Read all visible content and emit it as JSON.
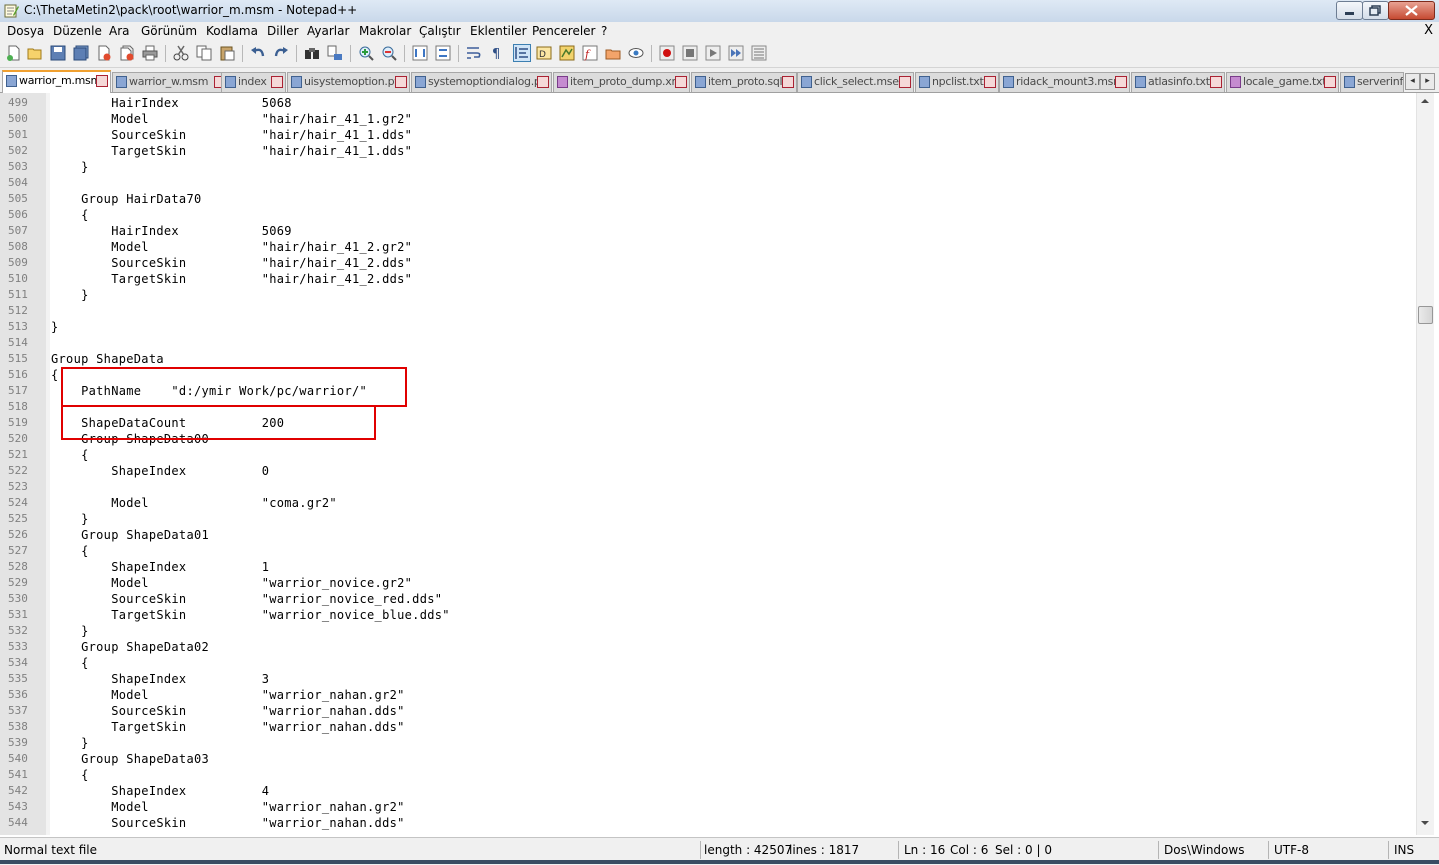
{
  "window": {
    "title": "C:\\ThetaMetin2\\pack\\root\\warrior_m.msm - Notepad++",
    "icon": "notepad-icon"
  },
  "menu": {
    "items": [
      "Dosya",
      "Düzenle",
      "Ara",
      "Görünüm",
      "Kodlama",
      "Diller",
      "Ayarlar",
      "Makrolar",
      "Çalıştır",
      "Eklentiler",
      "Pencereler",
      "?"
    ],
    "close_doc": "X"
  },
  "toolbar": {
    "icons": [
      "new-file-icon",
      "open-file-icon",
      "save-icon",
      "save-all-icon",
      "close-icon",
      "close-all-icon",
      "print-icon",
      "cut-icon",
      "copy-icon",
      "paste-icon",
      "undo-icon",
      "redo-icon",
      "find-icon",
      "replace-icon",
      "zoom-in-icon",
      "zoom-out-icon",
      "sync-v-icon",
      "sync-h-icon",
      "word-wrap-icon",
      "show-all-chars-icon",
      "indent-guide-icon",
      "udl-icon",
      "doc-map-icon",
      "function-list-icon",
      "folder-as-workspace-icon",
      "monitor-icon",
      "record-macro-icon",
      "stop-macro-icon",
      "play-macro-icon",
      "run-macro-multiple-icon",
      "save-macro-icon"
    ]
  },
  "tabs": [
    {
      "label": "warrior_m.msm",
      "active": true
    },
    {
      "label": "warrior_w.msm",
      "active": false
    },
    {
      "label": "index",
      "active": false
    },
    {
      "label": "uisystemoption.py",
      "active": false
    },
    {
      "label": "systemoptiondialog.py",
      "active": false
    },
    {
      "label": "item_proto_dump.xml",
      "active": false
    },
    {
      "label": "item_proto.sql",
      "active": false
    },
    {
      "label": "click_select.mse",
      "active": false
    },
    {
      "label": "npclist.txt",
      "active": false
    },
    {
      "label": "ridack_mount3.msm",
      "active": false
    },
    {
      "label": "atlasinfo.txt",
      "active": false
    },
    {
      "label": "locale_game.txt",
      "active": false
    },
    {
      "label": "serverinfo",
      "active": false
    }
  ],
  "editor": {
    "lines": [
      {
        "n": "499",
        "text": "        HairIndex           5068"
      },
      {
        "n": "500",
        "text": "        Model               \"hair/hair_41_1.gr2\""
      },
      {
        "n": "501",
        "text": "        SourceSkin          \"hair/hair_41_1.dds\""
      },
      {
        "n": "502",
        "text": "        TargetSkin          \"hair/hair_41_1.dds\""
      },
      {
        "n": "503",
        "text": "    }"
      },
      {
        "n": "504",
        "text": ""
      },
      {
        "n": "505",
        "text": "    Group HairData70"
      },
      {
        "n": "506",
        "text": "    {"
      },
      {
        "n": "507",
        "text": "        HairIndex           5069"
      },
      {
        "n": "508",
        "text": "        Model               \"hair/hair_41_2.gr2\""
      },
      {
        "n": "509",
        "text": "        SourceSkin          \"hair/hair_41_2.dds\""
      },
      {
        "n": "510",
        "text": "        TargetSkin          \"hair/hair_41_2.dds\""
      },
      {
        "n": "511",
        "text": "    }"
      },
      {
        "n": "512",
        "text": ""
      },
      {
        "n": "513",
        "text": "}"
      },
      {
        "n": "514",
        "text": ""
      },
      {
        "n": "515",
        "text": "Group ShapeData"
      },
      {
        "n": "516",
        "text": "{"
      },
      {
        "n": "517",
        "text": "    PathName    \"d:/ymir Work/pc/warrior/\""
      },
      {
        "n": "518",
        "text": ""
      },
      {
        "n": "519",
        "text": "    ShapeDataCount          200"
      },
      {
        "n": "520",
        "text": "    Group ShapeData00"
      },
      {
        "n": "521",
        "text": "    {"
      },
      {
        "n": "522",
        "text": "        ShapeIndex          0"
      },
      {
        "n": "523",
        "text": ""
      },
      {
        "n": "524",
        "text": "        Model               \"coma.gr2\""
      },
      {
        "n": "525",
        "text": "    }"
      },
      {
        "n": "526",
        "text": "    Group ShapeData01"
      },
      {
        "n": "527",
        "text": "    {"
      },
      {
        "n": "528",
        "text": "        ShapeIndex          1"
      },
      {
        "n": "529",
        "text": "        Model               \"warrior_novice.gr2\""
      },
      {
        "n": "530",
        "text": "        SourceSkin          \"warrior_novice_red.dds\""
      },
      {
        "n": "531",
        "text": "        TargetSkin          \"warrior_novice_blue.dds\""
      },
      {
        "n": "532",
        "text": "    }"
      },
      {
        "n": "533",
        "text": "    Group ShapeData02"
      },
      {
        "n": "534",
        "text": "    {"
      },
      {
        "n": "535",
        "text": "        ShapeIndex          3"
      },
      {
        "n": "536",
        "text": "        Model               \"warrior_nahan.gr2\""
      },
      {
        "n": "537",
        "text": "        SourceSkin          \"warrior_nahan.dds\""
      },
      {
        "n": "538",
        "text": "        TargetSkin          \"warrior_nahan.dds\""
      },
      {
        "n": "539",
        "text": "    }"
      },
      {
        "n": "540",
        "text": "    Group ShapeData03"
      },
      {
        "n": "541",
        "text": "    {"
      },
      {
        "n": "542",
        "text": "        ShapeIndex          4"
      },
      {
        "n": "543",
        "text": "        Model               \"warrior_nahan.gr2\""
      },
      {
        "n": "544",
        "text": "        SourceSkin          \"warrior_nahan.dds\""
      }
    ],
    "highlight_color": "#e00000"
  },
  "status": {
    "file_type": "Normal text file",
    "length": "length : 42507",
    "lines": "lines : 1817",
    "ln": "Ln : 16",
    "col": "Col : 6",
    "sel": "Sel : 0 | 0",
    "eol": "Dos\\Windows",
    "encoding": "UTF-8",
    "mode": "INS"
  }
}
